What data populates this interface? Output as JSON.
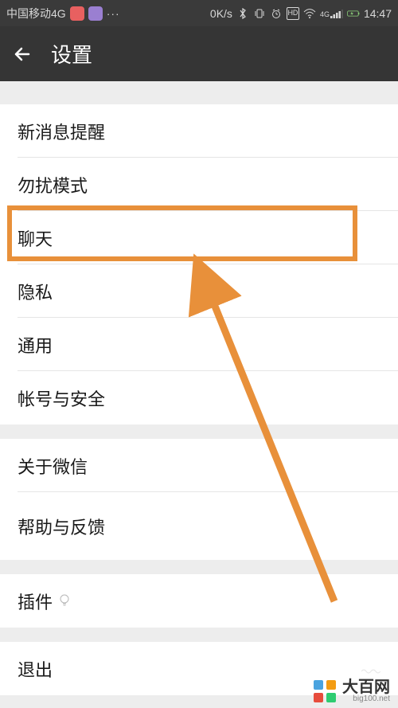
{
  "status_bar": {
    "carrier": "中国移动4G",
    "speed": "0K/s",
    "time": "14:47",
    "network_badge": "4G",
    "hd_badge": "HD"
  },
  "header": {
    "title": "设置"
  },
  "groups": [
    {
      "items": [
        {
          "label": "新消息提醒"
        },
        {
          "label": "勿扰模式"
        },
        {
          "label": "聊天",
          "highlighted": true
        },
        {
          "label": "隐私"
        },
        {
          "label": "通用"
        },
        {
          "label": "帐号与安全"
        }
      ]
    },
    {
      "items": [
        {
          "label": "关于微信"
        },
        {
          "label": "帮助与反馈"
        }
      ]
    },
    {
      "items": [
        {
          "label": "插件",
          "has_bulb": true
        }
      ]
    },
    {
      "items": [
        {
          "label": "退出",
          "has_squiggle": true
        }
      ]
    }
  ],
  "annotation": {
    "highlight_color": "#e8903a",
    "arrow_color": "#e8903a"
  },
  "watermark": {
    "brand": "大百网",
    "url": "big100.net"
  }
}
